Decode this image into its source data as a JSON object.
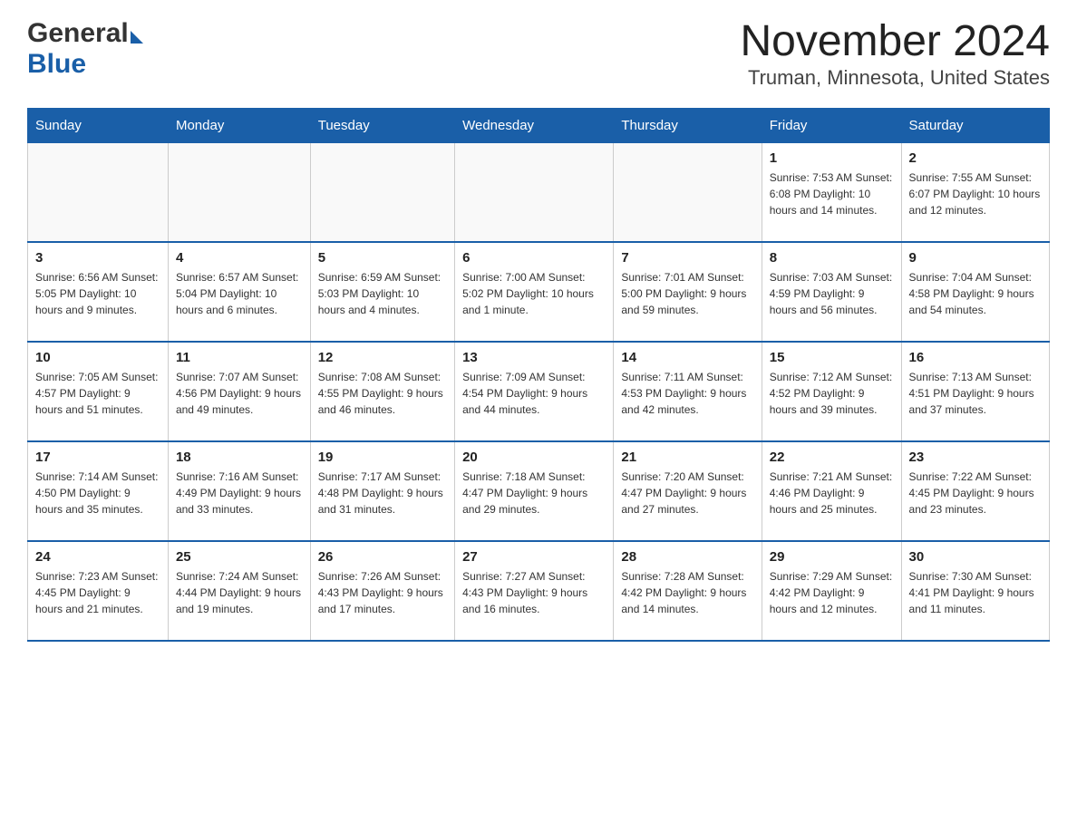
{
  "logo": {
    "general": "General",
    "blue": "Blue"
  },
  "title": "November 2024",
  "subtitle": "Truman, Minnesota, United States",
  "weekdays": [
    "Sunday",
    "Monday",
    "Tuesday",
    "Wednesday",
    "Thursday",
    "Friday",
    "Saturday"
  ],
  "weeks": [
    [
      {
        "day": "",
        "info": ""
      },
      {
        "day": "",
        "info": ""
      },
      {
        "day": "",
        "info": ""
      },
      {
        "day": "",
        "info": ""
      },
      {
        "day": "",
        "info": ""
      },
      {
        "day": "1",
        "info": "Sunrise: 7:53 AM\nSunset: 6:08 PM\nDaylight: 10 hours\nand 14 minutes."
      },
      {
        "day": "2",
        "info": "Sunrise: 7:55 AM\nSunset: 6:07 PM\nDaylight: 10 hours\nand 12 minutes."
      }
    ],
    [
      {
        "day": "3",
        "info": "Sunrise: 6:56 AM\nSunset: 5:05 PM\nDaylight: 10 hours\nand 9 minutes."
      },
      {
        "day": "4",
        "info": "Sunrise: 6:57 AM\nSunset: 5:04 PM\nDaylight: 10 hours\nand 6 minutes."
      },
      {
        "day": "5",
        "info": "Sunrise: 6:59 AM\nSunset: 5:03 PM\nDaylight: 10 hours\nand 4 minutes."
      },
      {
        "day": "6",
        "info": "Sunrise: 7:00 AM\nSunset: 5:02 PM\nDaylight: 10 hours\nand 1 minute."
      },
      {
        "day": "7",
        "info": "Sunrise: 7:01 AM\nSunset: 5:00 PM\nDaylight: 9 hours\nand 59 minutes."
      },
      {
        "day": "8",
        "info": "Sunrise: 7:03 AM\nSunset: 4:59 PM\nDaylight: 9 hours\nand 56 minutes."
      },
      {
        "day": "9",
        "info": "Sunrise: 7:04 AM\nSunset: 4:58 PM\nDaylight: 9 hours\nand 54 minutes."
      }
    ],
    [
      {
        "day": "10",
        "info": "Sunrise: 7:05 AM\nSunset: 4:57 PM\nDaylight: 9 hours\nand 51 minutes."
      },
      {
        "day": "11",
        "info": "Sunrise: 7:07 AM\nSunset: 4:56 PM\nDaylight: 9 hours\nand 49 minutes."
      },
      {
        "day": "12",
        "info": "Sunrise: 7:08 AM\nSunset: 4:55 PM\nDaylight: 9 hours\nand 46 minutes."
      },
      {
        "day": "13",
        "info": "Sunrise: 7:09 AM\nSunset: 4:54 PM\nDaylight: 9 hours\nand 44 minutes."
      },
      {
        "day": "14",
        "info": "Sunrise: 7:11 AM\nSunset: 4:53 PM\nDaylight: 9 hours\nand 42 minutes."
      },
      {
        "day": "15",
        "info": "Sunrise: 7:12 AM\nSunset: 4:52 PM\nDaylight: 9 hours\nand 39 minutes."
      },
      {
        "day": "16",
        "info": "Sunrise: 7:13 AM\nSunset: 4:51 PM\nDaylight: 9 hours\nand 37 minutes."
      }
    ],
    [
      {
        "day": "17",
        "info": "Sunrise: 7:14 AM\nSunset: 4:50 PM\nDaylight: 9 hours\nand 35 minutes."
      },
      {
        "day": "18",
        "info": "Sunrise: 7:16 AM\nSunset: 4:49 PM\nDaylight: 9 hours\nand 33 minutes."
      },
      {
        "day": "19",
        "info": "Sunrise: 7:17 AM\nSunset: 4:48 PM\nDaylight: 9 hours\nand 31 minutes."
      },
      {
        "day": "20",
        "info": "Sunrise: 7:18 AM\nSunset: 4:47 PM\nDaylight: 9 hours\nand 29 minutes."
      },
      {
        "day": "21",
        "info": "Sunrise: 7:20 AM\nSunset: 4:47 PM\nDaylight: 9 hours\nand 27 minutes."
      },
      {
        "day": "22",
        "info": "Sunrise: 7:21 AM\nSunset: 4:46 PM\nDaylight: 9 hours\nand 25 minutes."
      },
      {
        "day": "23",
        "info": "Sunrise: 7:22 AM\nSunset: 4:45 PM\nDaylight: 9 hours\nand 23 minutes."
      }
    ],
    [
      {
        "day": "24",
        "info": "Sunrise: 7:23 AM\nSunset: 4:45 PM\nDaylight: 9 hours\nand 21 minutes."
      },
      {
        "day": "25",
        "info": "Sunrise: 7:24 AM\nSunset: 4:44 PM\nDaylight: 9 hours\nand 19 minutes."
      },
      {
        "day": "26",
        "info": "Sunrise: 7:26 AM\nSunset: 4:43 PM\nDaylight: 9 hours\nand 17 minutes."
      },
      {
        "day": "27",
        "info": "Sunrise: 7:27 AM\nSunset: 4:43 PM\nDaylight: 9 hours\nand 16 minutes."
      },
      {
        "day": "28",
        "info": "Sunrise: 7:28 AM\nSunset: 4:42 PM\nDaylight: 9 hours\nand 14 minutes."
      },
      {
        "day": "29",
        "info": "Sunrise: 7:29 AM\nSunset: 4:42 PM\nDaylight: 9 hours\nand 12 minutes."
      },
      {
        "day": "30",
        "info": "Sunrise: 7:30 AM\nSunset: 4:41 PM\nDaylight: 9 hours\nand 11 minutes."
      }
    ]
  ]
}
